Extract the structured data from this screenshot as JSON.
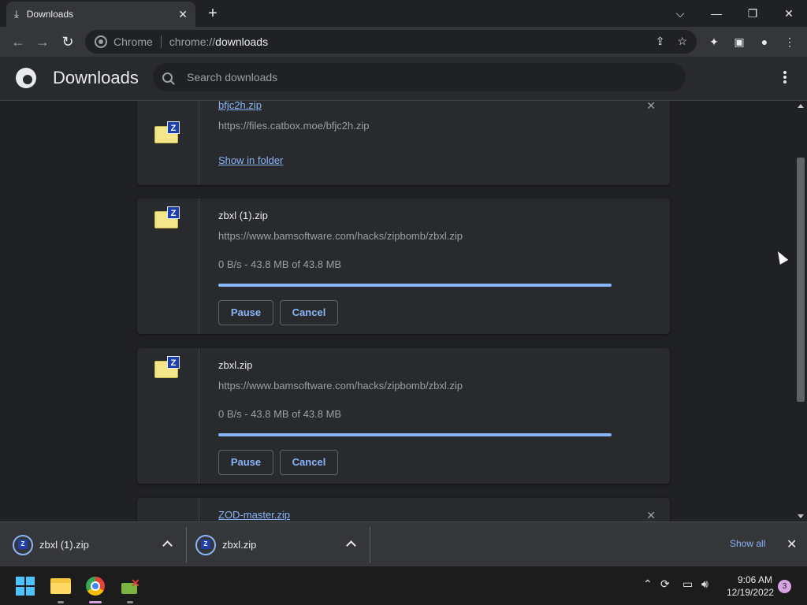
{
  "browser": {
    "tab_title": "Downloads",
    "tab_close": "✕",
    "new_tab": "+",
    "window_controls": {
      "dropdown": "⌵",
      "minimize": "—",
      "restore": "❐",
      "close": "✕"
    },
    "nav": {
      "back": "←",
      "forward": "→",
      "reload": "↻"
    },
    "omnibox": {
      "site_label": "Chrome",
      "url_scheme": "chrome://",
      "url_host": "downloads"
    }
  },
  "downloads_page": {
    "title": "Downloads",
    "search_placeholder": "Search downloads",
    "items": [
      {
        "filename": "bfjc2h.zip",
        "url": "https://files.catbox.moe/bfjc2h.zip",
        "action_link": "Show in folder",
        "remove": "✕"
      },
      {
        "filename": "zbxl (1).zip",
        "url": "https://www.bamsoftware.com/hacks/zipbomb/zbxl.zip",
        "status": "0 B/s - 43.8 MB of 43.8 MB",
        "progress_fraction": 1.0,
        "pause_label": "Pause",
        "cancel_label": "Cancel"
      },
      {
        "filename": "zbxl.zip",
        "url": "https://www.bamsoftware.com/hacks/zipbomb/zbxl.zip",
        "status": "0 B/s - 43.8 MB of 43.8 MB",
        "progress_fraction": 1.0,
        "pause_label": "Pause",
        "cancel_label": "Cancel"
      },
      {
        "filename": "ZOD-master.zip",
        "remove": "✕"
      }
    ]
  },
  "shelf": {
    "items": [
      {
        "filename": "zbxl (1).zip",
        "icon_letter": "Z"
      },
      {
        "filename": "zbxl.zip",
        "icon_letter": "Z"
      }
    ],
    "show_all": "Show all",
    "close": "✕"
  },
  "taskbar": {
    "clock_time": "9:06 AM",
    "clock_date": "12/19/2022",
    "notification_count": "3"
  },
  "colors": {
    "accent": "#8ab4f8",
    "background": "#202124",
    "card": "#292a2d"
  }
}
